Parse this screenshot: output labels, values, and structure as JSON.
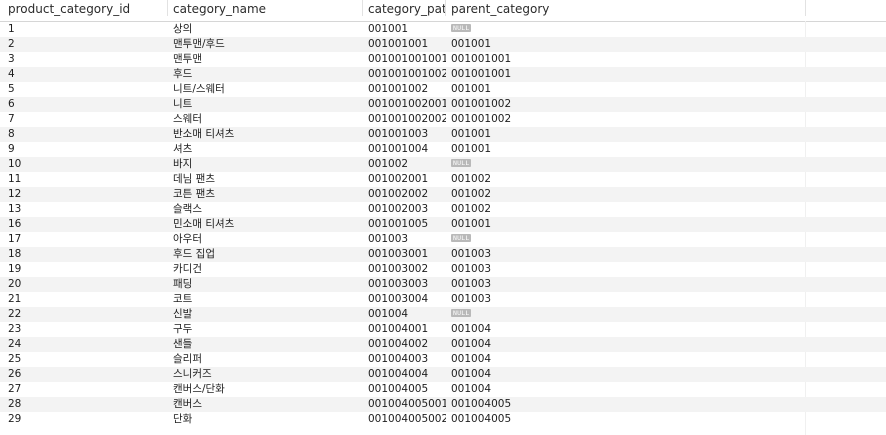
{
  "columns": [
    "product_category_id",
    "category_name",
    "category_path",
    "parent_category"
  ],
  "null_label": "NULL",
  "rows": [
    {
      "id": "1",
      "name": "상의",
      "path": "001001",
      "parent": null
    },
    {
      "id": "2",
      "name": "맨투맨/후드",
      "path": "001001001",
      "parent": "001001"
    },
    {
      "id": "3",
      "name": "맨투맨",
      "path": "001001001001",
      "parent": "001001001"
    },
    {
      "id": "4",
      "name": "후드",
      "path": "001001001002",
      "parent": "001001001"
    },
    {
      "id": "5",
      "name": "니트/스웨터",
      "path": "001001002",
      "parent": "001001"
    },
    {
      "id": "6",
      "name": "니트",
      "path": "001001002001",
      "parent": "001001002"
    },
    {
      "id": "7",
      "name": "스웨터",
      "path": "001001002002",
      "parent": "001001002"
    },
    {
      "id": "8",
      "name": "반소매 티셔츠",
      "path": "001001003",
      "parent": "001001"
    },
    {
      "id": "9",
      "name": "셔츠",
      "path": "001001004",
      "parent": "001001"
    },
    {
      "id": "10",
      "name": "바지",
      "path": "001002",
      "parent": null
    },
    {
      "id": "11",
      "name": "데님 팬츠",
      "path": "001002001",
      "parent": "001002"
    },
    {
      "id": "12",
      "name": "코튼 팬츠",
      "path": "001002002",
      "parent": "001002"
    },
    {
      "id": "13",
      "name": "슬랙스",
      "path": "001002003",
      "parent": "001002"
    },
    {
      "id": "16",
      "name": "민소매 티셔츠",
      "path": "001001005",
      "parent": "001001"
    },
    {
      "id": "17",
      "name": "아우터",
      "path": "001003",
      "parent": null
    },
    {
      "id": "18",
      "name": "후드 집업",
      "path": "001003001",
      "parent": "001003"
    },
    {
      "id": "19",
      "name": "카디건",
      "path": "001003002",
      "parent": "001003"
    },
    {
      "id": "20",
      "name": "패딩",
      "path": "001003003",
      "parent": "001003"
    },
    {
      "id": "21",
      "name": "코트",
      "path": "001003004",
      "parent": "001003"
    },
    {
      "id": "22",
      "name": "신발",
      "path": "001004",
      "parent": null
    },
    {
      "id": "23",
      "name": "구두",
      "path": "001004001",
      "parent": "001004"
    },
    {
      "id": "24",
      "name": "샌들",
      "path": "001004002",
      "parent": "001004"
    },
    {
      "id": "25",
      "name": "슬리퍼",
      "path": "001004003",
      "parent": "001004"
    },
    {
      "id": "26",
      "name": "스니커즈",
      "path": "001004004",
      "parent": "001004"
    },
    {
      "id": "27",
      "name": "캔버스/단화",
      "path": "001004005",
      "parent": "001004"
    },
    {
      "id": "28",
      "name": "캔버스",
      "path": "001004005001",
      "parent": "001004005"
    },
    {
      "id": "29",
      "name": "단화",
      "path": "001004005002",
      "parent": "001004005"
    }
  ]
}
